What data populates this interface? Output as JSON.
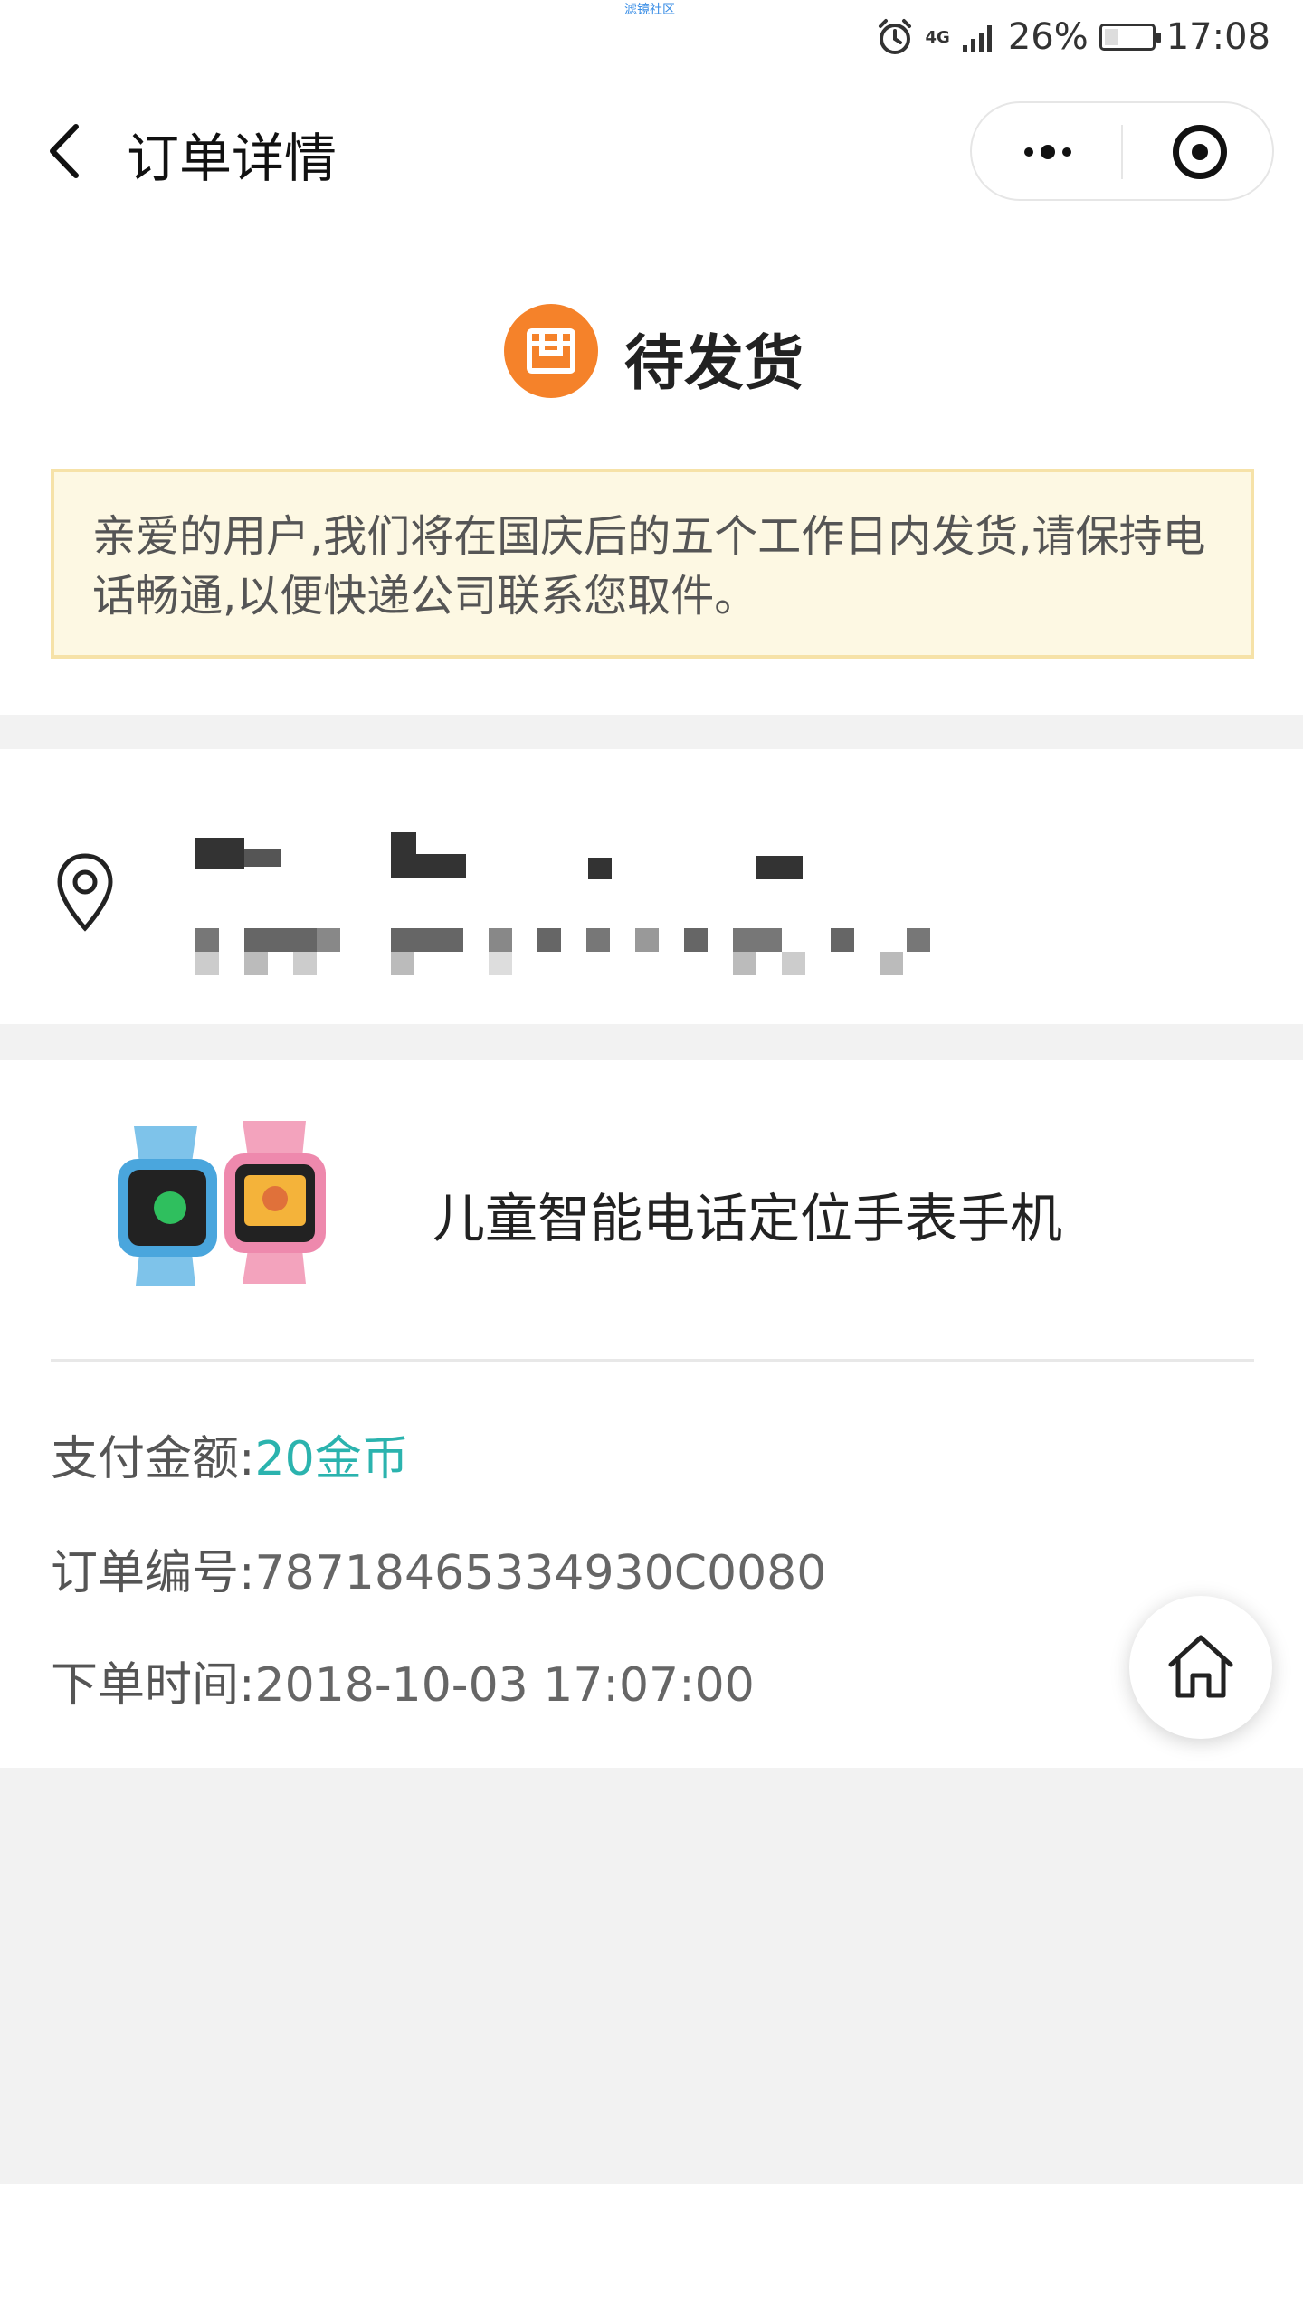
{
  "status_bar": {
    "top_caption": "滤镜社区",
    "network": "4G",
    "battery": "26%",
    "time": "17:08",
    "icons": [
      "alarm-icon",
      "signal-icon",
      "battery-icon"
    ]
  },
  "nav": {
    "title": "订单详情",
    "back_icon": "chevron-left-icon",
    "more_icon": "more-dots-icon",
    "close_icon": "target-circle-icon"
  },
  "order_status": {
    "label": "待发货",
    "icon": "package-box-icon",
    "icon_color": "#f5822a"
  },
  "notice": {
    "text": "亲爱的用户,我们将在国庆后的五个工作日内发货,请保持电话畅通,以便快递公司联系您取件。"
  },
  "address": {
    "icon": "location-pin-icon"
  },
  "product": {
    "name": "儿童智能电话定位手表手机",
    "image": "kids-smartwatch-image"
  },
  "details": {
    "amount_label": "支付金额:",
    "amount_value": "20金币",
    "order_no_label": "订单编号:",
    "order_no_value": "78718465334930C0080",
    "time_label": "下单时间:",
    "time_value": "2018-10-03 17:07:00"
  },
  "floating": {
    "home_icon": "home-icon"
  },
  "colors": {
    "accent": "#2bb3ae",
    "status_orange": "#f5822a",
    "notice_bg": "#fdf8e3",
    "notice_border": "#f6e2a8"
  }
}
